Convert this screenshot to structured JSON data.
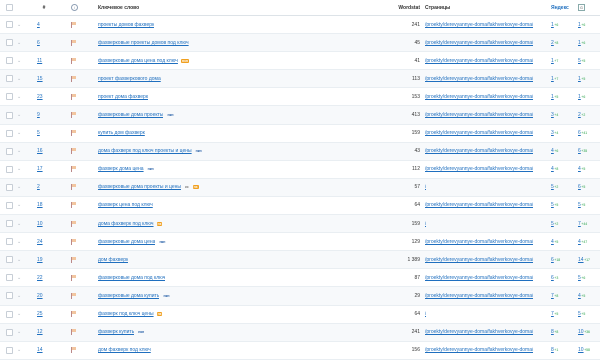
{
  "header": {
    "num_label": "#",
    "info_icon": "i",
    "keyword_label": "Ключевое слово",
    "wordstat_label": "Wordstat",
    "pages_label": "Страницы",
    "yandex_label": "Яндекс",
    "google_icon": "G"
  },
  "rows": [
    {
      "num": "4",
      "kw": "проекты домов фахверк",
      "tags": [],
      "ws": "241",
      "page": "/proekty/derevyannye-doma/fakhverkovye-doma/",
      "ya": "1",
      "yad": "+6",
      "g": "1",
      "gd": "+6"
    },
    {
      "num": "6",
      "kw": "фахверковые проекты домов под ключ",
      "tags": [],
      "ws": "45",
      "page": "/proekty/derevyannye-doma/fakhverkovye-doma/",
      "ya": "2",
      "yad": "+8",
      "g": "1",
      "gd": "+6"
    },
    {
      "num": "11",
      "kw": "фахверковые дома цена под ключ",
      "tags": [
        {
          "t": "нзн",
          "c": "org"
        }
      ],
      "ws": "41",
      "page": "/proekty/derevyannye-doma/fakhverkovye-doma/",
      "ya": "1",
      "yad": "+7",
      "g": "5",
      "gd": "+5"
    },
    {
      "num": "15",
      "kw": "проект фахверкового дома",
      "tags": [],
      "ws": "113",
      "page": "/proekty/derevyannye-doma/fakhverkovye-doma/",
      "ya": "1",
      "yad": "+7",
      "g": "1",
      "gd": "+5"
    },
    {
      "num": "23",
      "kw": "проект дома фахверк",
      "tags": [],
      "ws": "153",
      "page": "/proekty/derevyannye-doma/fakhverkovye-doma/",
      "ya": "1",
      "yad": "+5",
      "g": "1",
      "gd": "+6"
    },
    {
      "num": "9",
      "kw": "фахверковые дома проекты",
      "tags": [
        {
          "t": "нкн",
          "c": "blue"
        }
      ],
      "ws": "413",
      "page": "/proekty/derevyannye-doma/fakhverkovye-doma/",
      "ya": "3",
      "yad": "+4",
      "g": "2",
      "gd": "+2"
    },
    {
      "num": "5",
      "kw": "купить дом фахверк",
      "tags": [],
      "ws": "159",
      "page": "/proekty/derevyannye-doma/fakhverkovye-doma/",
      "ya": "3",
      "yad": "+4",
      "g": "6",
      "gd": "+41"
    },
    {
      "num": "16",
      "kw": "дома фахверк под ключ проекты и цены",
      "tags": [
        {
          "t": "нкн",
          "c": "blue"
        }
      ],
      "ws": "43",
      "page": "/proekty/derevyannye-doma/fakhverkovye-doma/",
      "ya": "4",
      "yad": "+6",
      "g": "6",
      "gd": "+35"
    },
    {
      "num": "17",
      "kw": "фахверк дома цена",
      "tags": [
        {
          "t": "нкн",
          "c": "blue"
        }
      ],
      "ws": "112",
      "page": "/proekty/derevyannye-doma/fakhverkovye-doma/",
      "ya": "4",
      "yad": "+8",
      "g": "4",
      "gd": "+5"
    },
    {
      "num": "2",
      "kw": "фахверковые дома проекты и цены",
      "tags": [
        {
          "t": "кс",
          "c": "gray"
        },
        {
          "t": "нз",
          "c": "org"
        }
      ],
      "ws": "57",
      "page": "/",
      "ya": "5",
      "yad": "+2",
      "g": "6",
      "gd": "+5"
    },
    {
      "num": "18",
      "kw": "фахверк цена под ключ",
      "tags": [],
      "ws": "64",
      "page": "/proekty/derevyannye-doma/fakhverkovye-doma/",
      "ya": "5",
      "yad": "+5",
      "g": "5",
      "gd": "+5"
    },
    {
      "num": "10",
      "kw": "дома фахверк под ключ",
      "tags": [
        {
          "t": "нз",
          "c": "org"
        }
      ],
      "ws": "159",
      "page": "/",
      "ya": "5",
      "yad": "+2",
      "g": "7",
      "gd": "+44"
    },
    {
      "num": "24",
      "kw": "фахверковые дома цена",
      "tags": [
        {
          "t": "нкн",
          "c": "blue"
        }
      ],
      "ws": "129",
      "page": "/proekty/derevyannye-doma/fakhverkovye-doma/",
      "ya": "4",
      "yad": "+5",
      "g": "4",
      "gd": "+47"
    },
    {
      "num": "19",
      "kw": "дом фахверк",
      "tags": [],
      "ws": "1 389",
      "page": "/proekty/derevyannye-doma/fakhverkovye-doma/",
      "ya": "6",
      "yad": "+18",
      "g": "14",
      "gd": "+17"
    },
    {
      "num": "22",
      "kw": "фахверковые дома под ключ",
      "tags": [],
      "ws": "87",
      "page": "/proekty/derevyannye-doma/fakhverkovye-doma/",
      "ya": "6",
      "yad": "+3",
      "g": "5",
      "gd": "+6"
    },
    {
      "num": "20",
      "kw": "фахверковые дома купить",
      "tags": [
        {
          "t": "нкн",
          "c": "blue"
        }
      ],
      "ws": "29",
      "page": "/proekty/derevyannye-doma/fakhverkovye-doma/",
      "ya": "7",
      "yad": "+8",
      "g": "4",
      "gd": "+5"
    },
    {
      "num": "25",
      "kw": "фахверк под ключ цены",
      "tags": [
        {
          "t": "нз",
          "c": "org"
        }
      ],
      "ws": "64",
      "page": "/",
      "ya": "7",
      "yad": "+5",
      "g": "5",
      "gd": "+5"
    },
    {
      "num": "12",
      "kw": "фахверк купить",
      "tags": [
        {
          "t": "нкн",
          "c": "blue"
        }
      ],
      "ws": "241",
      "page": "/proekty/derevyannye-doma/fakhverkovye-doma/",
      "ya": "8",
      "yad": "+8",
      "g": "10",
      "gd": "+36"
    },
    {
      "num": "14",
      "kw": "дом фахверк под ключ",
      "tags": [],
      "ws": "156",
      "page": "/proekty/derevyannye-doma/fakhverkovye-doma/",
      "ya": "8",
      "yad": "+1",
      "g": "10",
      "gd": "+58"
    }
  ]
}
